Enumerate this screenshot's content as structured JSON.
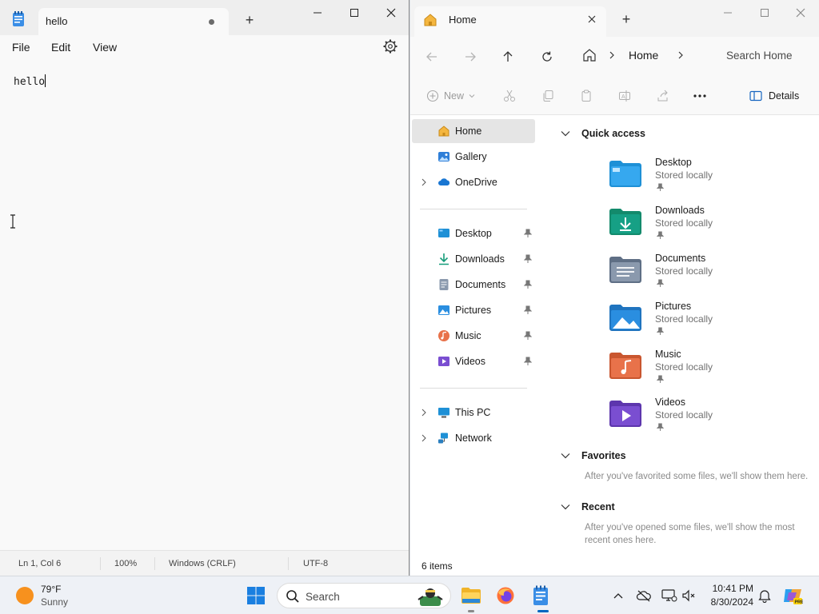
{
  "notepad": {
    "tab_title": "hello",
    "menu": {
      "file": "File",
      "edit": "Edit",
      "view": "View"
    },
    "content": "hello",
    "status": {
      "position": "Ln 1, Col 6",
      "zoom": "100%",
      "line_ending": "Windows (CRLF)",
      "encoding": "UTF-8"
    }
  },
  "explorer": {
    "tab_title": "Home",
    "breadcrumb": "Home",
    "search_placeholder": "Search Home",
    "toolbar": {
      "new_label": "New",
      "details_label": "Details"
    },
    "nav": {
      "home": "Home",
      "gallery": "Gallery",
      "onedrive": "OneDrive",
      "desktop": "Desktop",
      "downloads": "Downloads",
      "documents": "Documents",
      "pictures": "Pictures",
      "music": "Music",
      "videos": "Videos",
      "this_pc": "This PC",
      "network": "Network"
    },
    "quick_access": {
      "heading": "Quick access",
      "items": [
        {
          "name": "Desktop",
          "sub": "Stored locally",
          "color": "#1e90d6"
        },
        {
          "name": "Downloads",
          "sub": "Stored locally",
          "color": "#16a085"
        },
        {
          "name": "Documents",
          "sub": "Stored locally",
          "color": "#7b8da6"
        },
        {
          "name": "Pictures",
          "sub": "Stored locally",
          "color": "#2a8ee0"
        },
        {
          "name": "Music",
          "sub": "Stored locally",
          "color": "#e8724a"
        },
        {
          "name": "Videos",
          "sub": "Stored locally",
          "color": "#7a4ed1"
        }
      ]
    },
    "favorites": {
      "heading": "Favorites",
      "note": "After you've favorited some files, we'll show them here."
    },
    "recent": {
      "heading": "Recent",
      "note": "After you've opened some files, we'll show the most recent ones here."
    },
    "status_count": "6 items"
  },
  "taskbar": {
    "temperature": "79°F",
    "condition": "Sunny",
    "search_label": "Search",
    "time": "10:41 PM",
    "date": "8/30/2024"
  }
}
